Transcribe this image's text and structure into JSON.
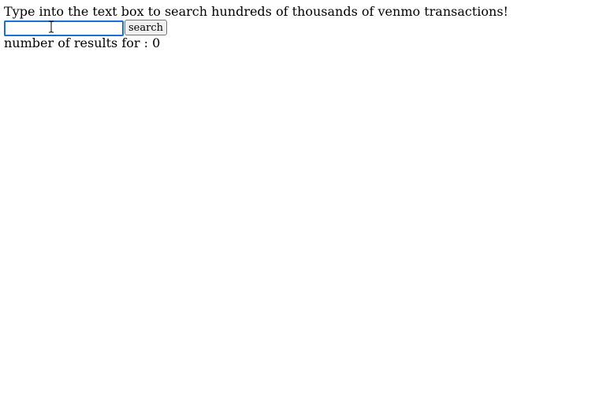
{
  "intro": {
    "text": "Type into the text box to search hundreds of thousands of venmo transactions!"
  },
  "search": {
    "value": "",
    "placeholder": "",
    "button_label": "search",
    "cursor_icon": "text-cursor-icon"
  },
  "results": {
    "prefix": "number of results for ",
    "query": "",
    "separator": ": ",
    "count": "0"
  },
  "colors": {
    "input_focus_border": "#1a6fd6",
    "button_background": "#efefef",
    "text": "#000000",
    "background": "#ffffff"
  }
}
